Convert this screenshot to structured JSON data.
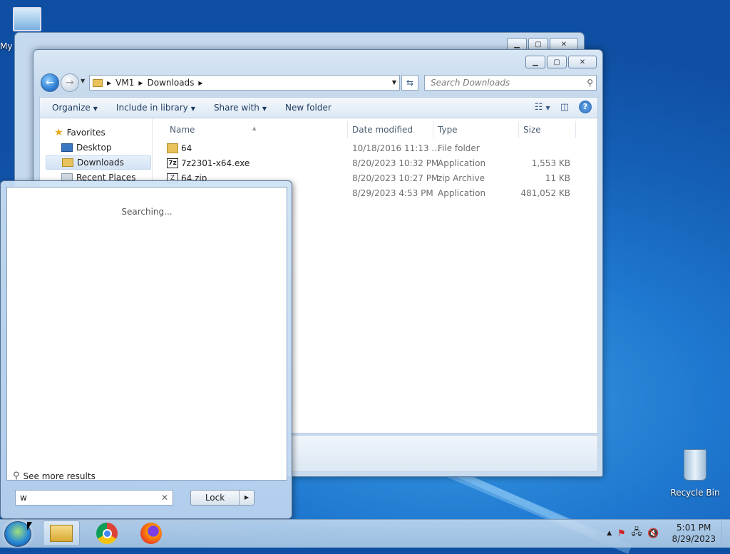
{
  "desktop": {
    "icons": [
      {
        "label": "My",
        "icon": "computer-icon"
      },
      {
        "label": "Recycle Bin",
        "icon": "recycle-bin-icon"
      }
    ]
  },
  "explorer": {
    "caption_buttons": [
      "minimize",
      "maximize",
      "close"
    ],
    "breadcrumb": [
      "VM1",
      "Downloads"
    ],
    "search_placeholder": "Search Downloads",
    "toolbar": {
      "organize": "Organize",
      "include_in_library": "Include in library",
      "share_with": "Share with",
      "new_folder": "New folder"
    },
    "nav": {
      "favorites": "Favorites",
      "desktop": "Desktop",
      "downloads": "Downloads",
      "recent_places": "Recent Places"
    },
    "columns": {
      "name": "Name",
      "date_modified": "Date modified",
      "type": "Type",
      "size": "Size"
    },
    "files": [
      {
        "name": "64",
        "date": "10/18/2016 11:13 ...",
        "type": "File folder",
        "size": "",
        "icon": "folder-icon"
      },
      {
        "name": "7z2301-x64.exe",
        "date": "8/20/2023 10:32 PM",
        "type": "Application",
        "size": "1,553 KB",
        "icon": "7z-icon"
      },
      {
        "name": "64.zip",
        "date": "8/20/2023 10:27 PM",
        "type": "zip Archive",
        "size": "11 KB",
        "icon": "zip-icon"
      },
      {
        "name": "",
        "date": "8/29/2023 4:53 PM",
        "type": "Application",
        "size": "481,052 KB",
        "icon": "app-icon"
      }
    ]
  },
  "start_menu": {
    "status": "Searching...",
    "see_more": "See more results",
    "search_value": "w",
    "lock_label": "Lock"
  },
  "taskbar": {
    "pinned": [
      "file-explorer-icon",
      "chrome-icon",
      "firefox-icon"
    ],
    "time": "5:01 PM",
    "date": "8/29/2023"
  },
  "colors": {
    "desktop": "#1f78cf",
    "taskbar": "#b9d0e8",
    "window_frame": "#c6d9ed"
  }
}
